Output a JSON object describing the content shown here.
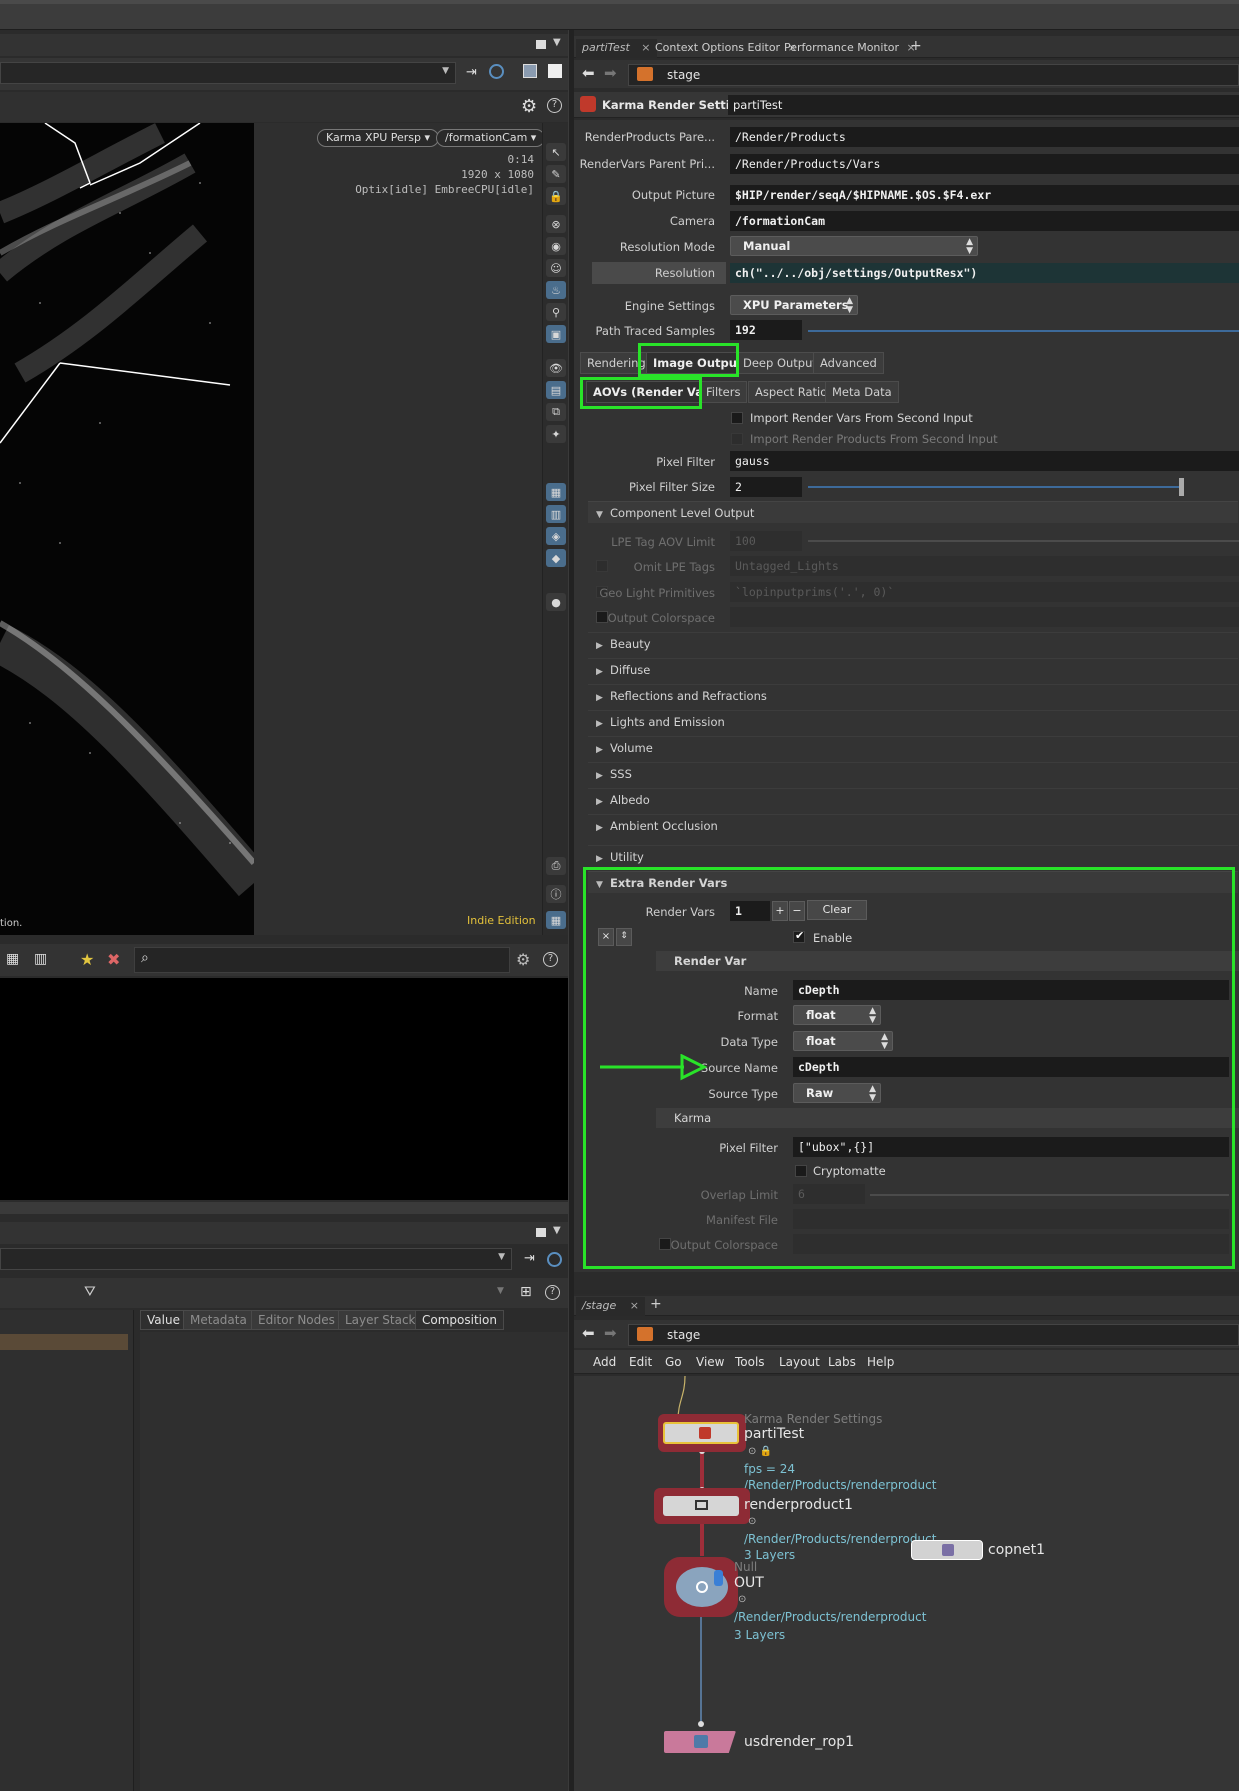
{
  "viewport": {
    "renderer_pill": "Karma XPU Persp",
    "camera_pill": "/formationCam",
    "time": "0:14",
    "resolution": "1920 x 1080",
    "engines": "Optix[idle] EmbreeCPU[idle]",
    "edition": "Indie Edition",
    "bottom_text": "tion."
  },
  "scene_graph": {
    "tabs": [
      "Value",
      "Metadata",
      "Editor Nodes",
      "Layer Stack",
      "Composition"
    ]
  },
  "param_tabs": [
    "partiTest",
    "Context Options Editor",
    "Performance Monitor"
  ],
  "param_path": "stage",
  "node": {
    "type": "Karma Render Settings",
    "name": "partiTest"
  },
  "params": {
    "renderproducts_label": "RenderProducts Pare...",
    "renderproducts_value": "/Render/Products",
    "rendervars_label": "RenderVars Parent Pri...",
    "rendervars_value": "/Render/Products/Vars",
    "output_picture_label": "Output Picture",
    "output_picture_value": "$HIP/render/seqA/$HIPNAME.$OS.$F4.exr",
    "camera_label": "Camera",
    "camera_value": "/formationCam",
    "resolution_mode_label": "Resolution Mode",
    "resolution_mode_value": "Manual",
    "resolution_label": "Resolution",
    "resolution_value": "ch(\"../../obj/settings/OutputResx\")",
    "engine_label": "Engine Settings",
    "engine_value": "XPU Parameters",
    "samples_label": "Path Traced Samples",
    "samples_value": "192",
    "main_tabs": [
      "Rendering",
      "Image Output",
      "Deep Output",
      "Advanced"
    ],
    "sub_tabs": [
      "AOVs (Render Vars)",
      "Filters",
      "Aspect Ratio",
      "Meta Data"
    ],
    "import_vars": "Import Render Vars From Second Input",
    "import_products": "Import Render Products From Second Input",
    "pixel_filter_label": "Pixel Filter",
    "pixel_filter_value": "gauss",
    "pixel_filter_size_label": "Pixel Filter Size",
    "pixel_filter_size_value": "2",
    "component_folder": "Component Level Output",
    "lpe_limit_label": "LPE Tag AOV Limit",
    "lpe_limit_value": "100",
    "omit_lpe_label": "Omit LPE Tags",
    "omit_lpe_value": "Untagged_Lights",
    "geo_light_label": "Geo Light Primitives",
    "geo_light_value": "`lopinputprims('.', 0)`",
    "output_colorspace_label": "Output Colorspace",
    "folders": [
      "Beauty",
      "Diffuse",
      "Reflections and Refractions",
      "Lights and Emission",
      "Volume",
      "SSS",
      "Albedo",
      "Ambient Occlusion",
      "Utility"
    ],
    "extra_folder": "Extra Render Vars",
    "render_vars_label": "Render Vars",
    "render_vars_value": "1",
    "clear_label": "Clear",
    "enable_label": "Enable",
    "render_var_header": "Render Var",
    "name_label": "Name",
    "name_value": "cDepth",
    "format_label": "Format",
    "format_value": "float",
    "datatype_label": "Data Type",
    "datatype_value": "float",
    "source_name_label": "Source Name",
    "source_name_value": "cDepth",
    "source_type_label": "Source Type",
    "source_type_value": "Raw",
    "karma_header": "Karma",
    "rv_pixel_filter_label": "Pixel Filter",
    "rv_pixel_filter_value": "[\"ubox\",{}]",
    "cryptomatte_label": "Cryptomatte",
    "overlap_label": "Overlap Limit",
    "overlap_value": "6",
    "manifest_label": "Manifest File",
    "rv_colorspace_label": "Output Colorspace"
  },
  "network": {
    "tab": "/stage",
    "path": "stage",
    "menu": [
      "Add",
      "Edit",
      "Go",
      "View",
      "Tools",
      "Layout",
      "Labs",
      "Help"
    ],
    "nodes": {
      "karma_type": "Karma Render Settings",
      "karma_name": "partiTest",
      "karma_fps": "fps = 24",
      "karma_path": "/Render/Products/renderproduct",
      "rp_name": "renderproduct1",
      "rp_path": "/Render/Products/renderproduct",
      "rp_layers": "3 Layers",
      "null_type": "Null",
      "null_name": "OUT",
      "null_path": "/Render/Products/renderproduct",
      "null_layers": "3 Layers",
      "cop_name": "copnet1",
      "rop_name": "usdrender_rop1"
    }
  },
  "colors": {
    "highlight": "#29e329",
    "node_sub": "#7dc2d3",
    "edition": "#e3c13b"
  }
}
